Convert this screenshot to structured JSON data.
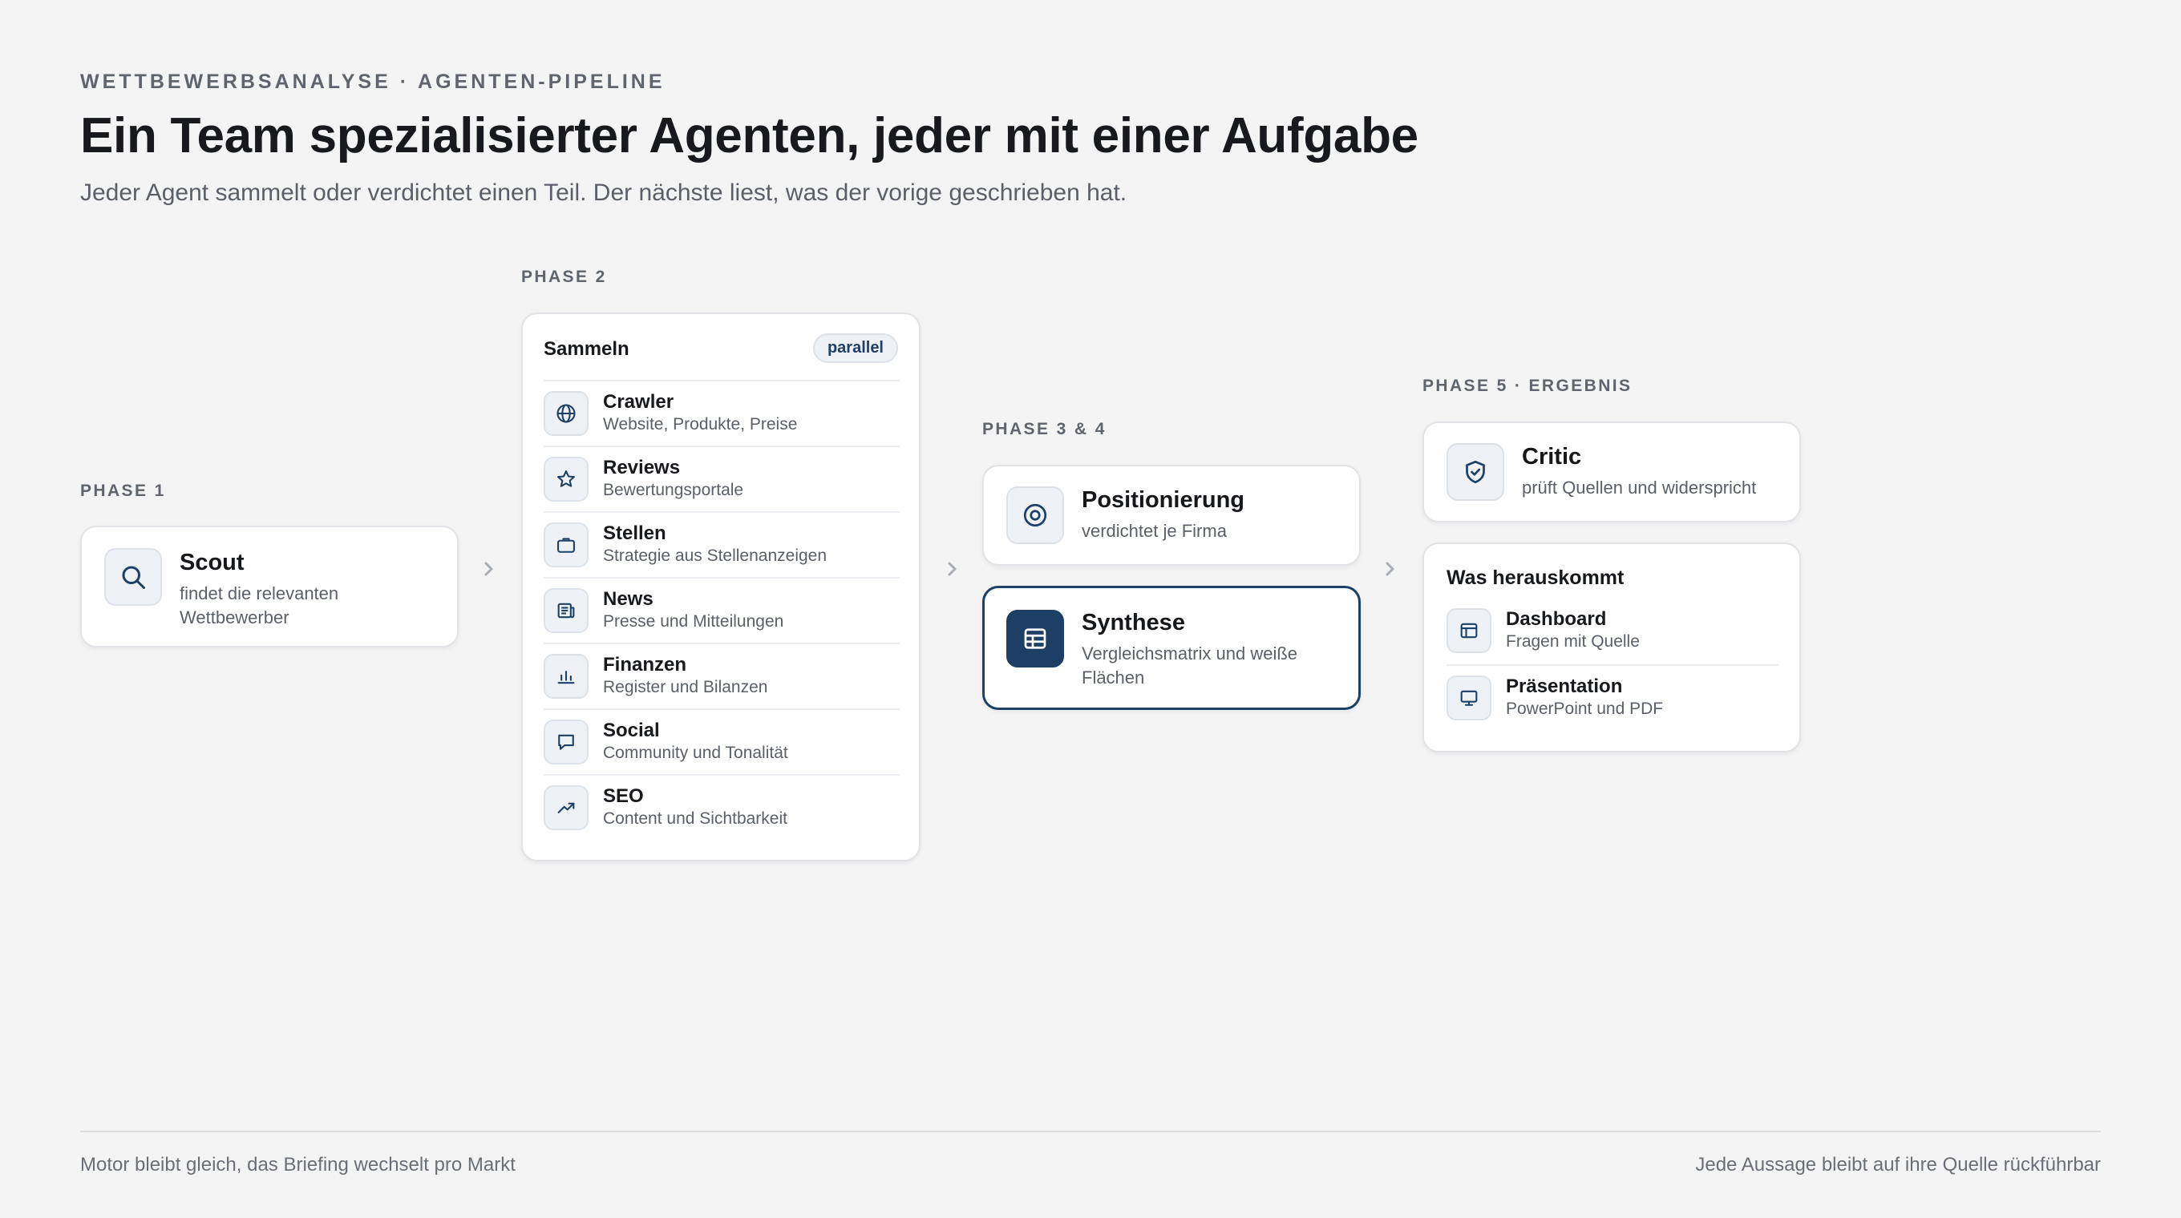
{
  "header": {
    "eyebrow": "WETTBEWERBSANALYSE · AGENTEN-PIPELINE",
    "title": "Ein Team spezialisierter Agenten, jeder mit einer Aufgabe",
    "subtitle": "Jeder Agent sammelt oder verdichtet einen Teil. Der nächste liest, was der vorige geschrieben hat."
  },
  "phase1": {
    "label": "PHASE 1",
    "agent": {
      "name": "Scout",
      "desc": "findet die relevanten Wettbewerber",
      "icon": "search-icon"
    }
  },
  "phase2": {
    "label": "PHASE 2",
    "card_title": "Sammeln",
    "badge": "parallel",
    "agents": [
      {
        "name": "Crawler",
        "desc": "Website, Produkte, Preise",
        "icon": "globe-icon"
      },
      {
        "name": "Reviews",
        "desc": "Bewertungsportale",
        "icon": "star-icon"
      },
      {
        "name": "Stellen",
        "desc": "Strategie aus Stellenanzeigen",
        "icon": "briefcase-icon"
      },
      {
        "name": "News",
        "desc": "Presse und Mitteilungen",
        "icon": "newspaper-icon"
      },
      {
        "name": "Finanzen",
        "desc": "Register und Bilanzen",
        "icon": "bar-chart-icon"
      },
      {
        "name": "Social",
        "desc": "Community und Tonalität",
        "icon": "chat-bubble-icon"
      },
      {
        "name": "SEO",
        "desc": "Content und Sichtbarkeit",
        "icon": "trending-up-icon"
      }
    ]
  },
  "phase34": {
    "label": "PHASE 3 & 4",
    "agents": [
      {
        "name": "Positionierung",
        "desc": "verdichtet je Firma",
        "icon": "target-icon"
      },
      {
        "name": "Synthese",
        "desc": "Vergleichsmatrix und weiße Flächen",
        "icon": "table-icon"
      }
    ]
  },
  "phase5": {
    "label": "PHASE 5 · ERGEBNIS",
    "critic": {
      "name": "Critic",
      "desc": "prüft Quellen und widerspricht",
      "icon": "shield-check-icon"
    },
    "output_title": "Was herauskommt",
    "outputs": [
      {
        "name": "Dashboard",
        "desc": "Fragen mit Quelle",
        "icon": "dashboard-icon"
      },
      {
        "name": "Präsentation",
        "desc": "PowerPoint und PDF",
        "icon": "monitor-icon"
      }
    ]
  },
  "footer": {
    "left": "Motor bleibt gleich, das Briefing wechselt pro Markt",
    "right": "Jede Aussage bleibt auf ihre Quelle rückführbar"
  },
  "colors": {
    "background": "#f4f4f4",
    "accent": "#1d3f66",
    "icon_bg": "#eef2f7",
    "muted_text": "#5b6068"
  }
}
